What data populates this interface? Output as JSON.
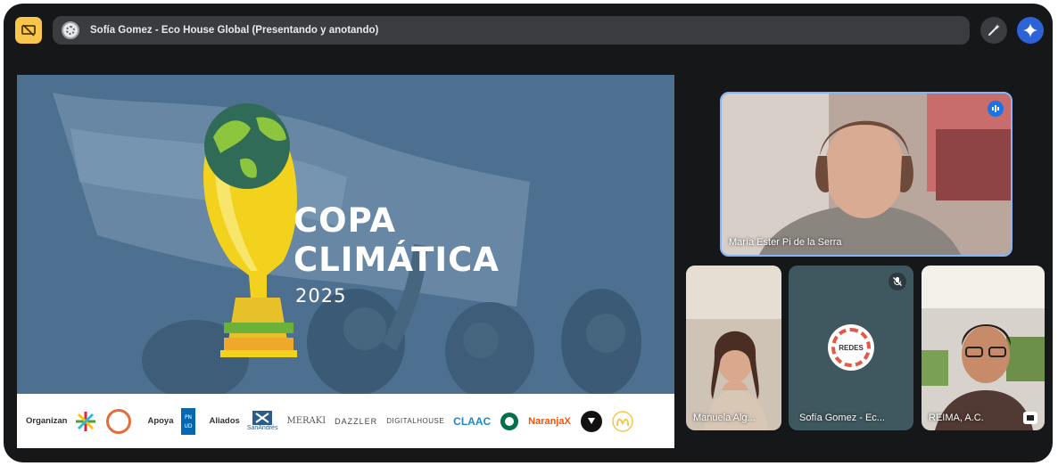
{
  "meeting": {
    "presenter_title": "Sofía Gomez - Eco House Global (Presentando y anotando)"
  },
  "slide": {
    "title_line1": "COPA",
    "title_line2": "CLIMÁTICA",
    "year": "2025",
    "sponsors": {
      "organizan_label": "Organizan",
      "apoya_label": "Apoya",
      "aliados_label": "Aliados",
      "logos": [
        "SanAndrés",
        "MERAKI",
        "DAZZLER",
        "DIGITALHOUSE",
        "CLAAC",
        "NaranjaX"
      ]
    }
  },
  "participants": [
    {
      "name": "María Ester Pi de la Serra",
      "status": "speaking"
    },
    {
      "name": "Manuela Alg...",
      "status": "video"
    },
    {
      "name": "Sofía Gomez - Ec...",
      "status": "muted",
      "logo_text": "REDES"
    },
    {
      "name": "REIMA, A.C.",
      "status": "video"
    }
  ],
  "colors": {
    "accent_yellow": "#f9c54a",
    "speaking_blue": "#8ab4f8",
    "slide_blue": "#4d6f8e"
  },
  "icons": {
    "present": "present-screen-off-icon",
    "presenter_avatar": "eco-house-avatar-icon",
    "edit": "pen-sparkle-icon",
    "assistant": "gemini-sparkle-icon",
    "speaking": "audio-level-icon",
    "muted": "mic-off-icon",
    "camera": "camera-frame-icon"
  }
}
